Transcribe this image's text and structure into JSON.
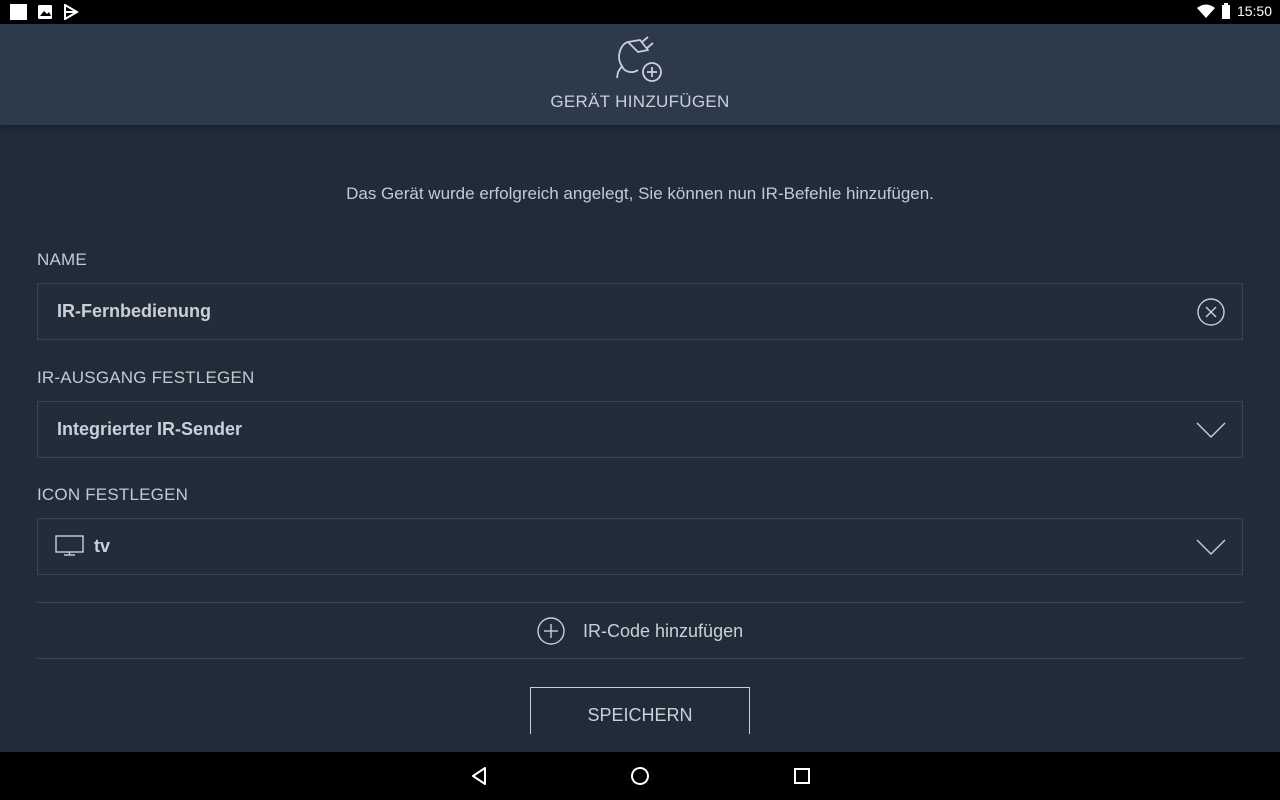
{
  "status_bar": {
    "time": "15:50",
    "left_icons": [
      "notification-square-icon",
      "image-icon",
      "play-store-icon"
    ],
    "right_icons": [
      "wifi-icon",
      "battery-icon"
    ]
  },
  "header": {
    "icon": "plug-add-icon",
    "title": "GERÄT HINZUFÜGEN"
  },
  "message": "Das Gerät wurde erfolgreich angelegt, Sie können nun IR-Befehle hinzufügen.",
  "name_section": {
    "label": "NAME",
    "value": "IR-Fernbedienung",
    "clear_icon": "clear-circle-icon"
  },
  "ir_output_section": {
    "label": "IR-AUSGANG FESTLEGEN",
    "selected": "Integrierter IR-Sender",
    "dropdown_icon": "chevron-down-icon"
  },
  "icon_section": {
    "label": "ICON FESTLEGEN",
    "selected": "tv",
    "selected_icon": "tv-icon",
    "dropdown_icon": "chevron-down-icon"
  },
  "add_code": {
    "label": "IR-Code hinzufügen",
    "icon": "plus-circle-icon"
  },
  "save_button": "SPEICHERN",
  "nav_bar": [
    "back-icon",
    "home-icon",
    "recents-icon"
  ],
  "colors": {
    "background": "#222b38",
    "header": "#2d3a4b",
    "text": "#c9d0d9",
    "border": "#3a4657"
  }
}
